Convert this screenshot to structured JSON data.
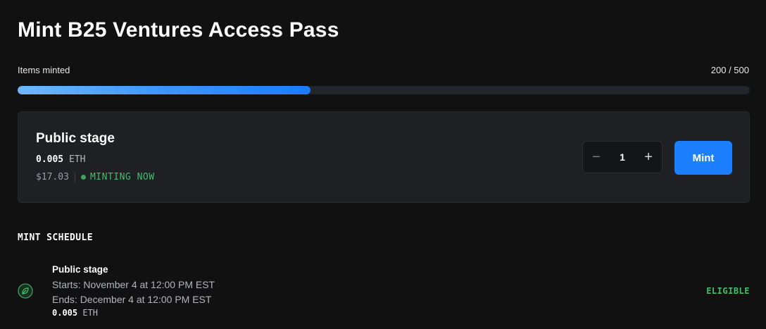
{
  "page": {
    "title": "Mint B25 Ventures Access Pass"
  },
  "progress": {
    "label": "Items minted",
    "count_text": "200 / 500",
    "minted": 200,
    "total": 500,
    "fill_fraction": 0.4
  },
  "stage": {
    "name": "Public stage",
    "price_amount": "0.005",
    "price_currency": "ETH",
    "fiat_price": "$17.03",
    "status": "MINTING NOW",
    "status_color": "#3fbf6a",
    "quantity": "1",
    "minus_symbol": "−",
    "plus_symbol": "+",
    "mint_label": "Mint",
    "accent_color": "#1b7fff"
  },
  "schedule": {
    "heading": "MINT SCHEDULE",
    "items": [
      {
        "name": "Public stage",
        "starts": "Starts: November 4 at 12:00 PM EST",
        "ends": "Ends: December 4 at 12:00 PM EST",
        "price_amount": "0.005",
        "price_currency": "ETH",
        "status": "ELIGIBLE",
        "icon": "leaf-icon"
      }
    ]
  }
}
